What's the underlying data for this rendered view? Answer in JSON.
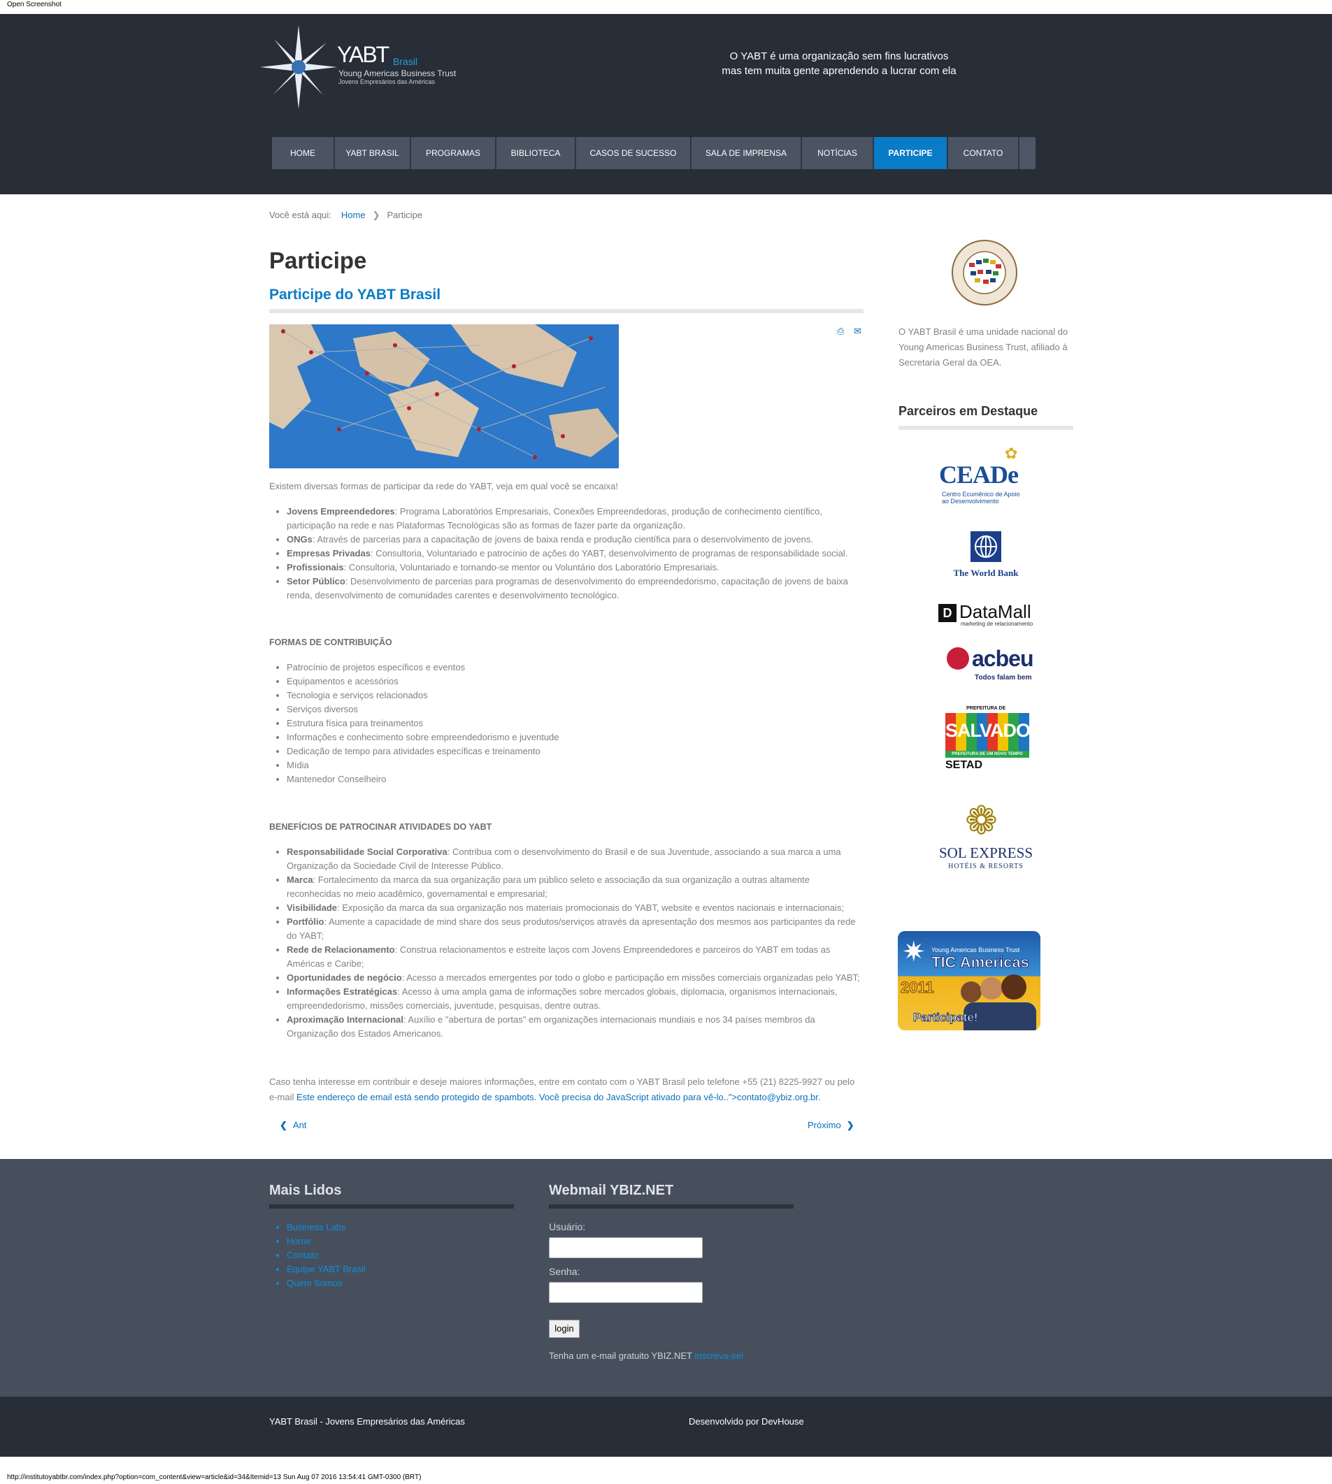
{
  "browser": {
    "top_label": "Open Screenshot",
    "status_url": "http://institutoyabtbr.com/index.php?option=com_content&view=article&id=34&Itemid=13 Sun Aug 07 2016 13:54:41 GMT-0300 (BRT)"
  },
  "header": {
    "logo": {
      "name": "YABT",
      "country": "Brasil",
      "line1": "Young Americas Business Trust",
      "line2": "Jovens Empresários das Américas"
    },
    "tagline_1": "O YABT é uma organização sem fins lucrativos",
    "tagline_2": "mas tem muita gente aprendendo a lucrar com ela"
  },
  "nav": [
    "HOME",
    "YABT BRASIL",
    "PROGRAMAS",
    "BIBLIOTECA",
    "CASOS DE SUCESSO",
    "SALA DE IMPRENSA",
    "NOTÍCIAS",
    "PARTICIPE",
    "CONTATO"
  ],
  "nav_active": "PARTICIPE",
  "breadcrumb": {
    "prefix": "Você está aqui:",
    "home": "Home",
    "current": "Participe"
  },
  "article": {
    "title": "Participe",
    "subtitle": "Participe do YABT Brasil",
    "intro": "Existem diversas formas de participar da rede do YABT, veja em qual você se encaixa!",
    "audiences": [
      {
        "term": "Jovens Empreendedores",
        "desc": ": Programa Laboratórios Empresariais, Conexões Empreendedoras, produção de conhecimento científico, participação na rede e nas Plataformas Tecnológicas são as formas de fazer parte da organização."
      },
      {
        "term": "ONGs",
        "desc": ": Através de parcerias para a capacitação de jovens de baixa renda e produção científica para o desenvolvimento de jovens."
      },
      {
        "term": "Empresas Privadas",
        "desc": ": Consultoria, Voluntariado e patrocínio de ações do YABT, desenvolvimento de programas de responsabilidade social."
      },
      {
        "term": "Profissionais",
        "desc": ": Consultoria, Voluntariado e tornando-se mentor ou Voluntário dos Laboratório Empresariais."
      },
      {
        "term": "Setor Público",
        "desc": ": Desenvolvimento de parcerias para programas de desenvolvimento do empreendedorismo, capacitação de jovens de baixa renda, desenvolvimento de comunidades carentes e desenvolvimento tecnológico."
      }
    ],
    "contrib_head": "FORMAS DE CONTRIBUIÇÃO",
    "contrib": [
      "Patrocínio de projetos específicos e eventos",
      "Equipamentos e acessórios",
      "Tecnologia e serviços relacionados",
      "Serviços diversos",
      "Estrutura física para treinamentos",
      "Informações e conhecimento sobre empreendedorismo e juventude",
      "Dedicação de tempo para atividades específicas e treinamento",
      "Mídia",
      "Mantenedor Conselheiro"
    ],
    "benefits_head": "BENEFÍCIOS DE PATROCINAR ATIVIDADES DO YABT",
    "benefits": [
      {
        "term": "Responsabilidade Social Corporativa",
        "desc": ": Contribua com o desenvolvimento do Brasil e de sua Juventude, associando a sua marca a uma Organização da Sociedade Civil de Interesse Público."
      },
      {
        "term": "Marca",
        "desc": ": Fortalecimento da marca da sua organização para um público seleto e associação da sua organização a outras altamente reconhecidas no meio acadêmico, governamental e empresarial;"
      },
      {
        "term": "Visibilidade",
        "desc": ": Exposição da marca da sua organização nos materiais promocionais do YABT, website e eventos nacionais e internacionais;"
      },
      {
        "term": "Portfólio",
        "desc": ": Aumente a capacidade de mind share dos seus produtos/serviços através da apresentação dos mesmos aos participantes da rede do YABT;"
      },
      {
        "term": "Rede de Relacionamento",
        "desc": ": Construa relacionamentos e estreite laços com Jovens Empreendedores e parceiros do YABT em todas as Américas e Caribe;"
      },
      {
        "term": "Oportunidades de negócio",
        "desc": ": Acesso a mercados emergentes por todo o globo e participação em missões comerciais organizadas pelo YABT;"
      },
      {
        "term": "Informações Estratégicas",
        "desc": ": Acesso à uma ampla gama de informações sobre mercados globais, diplomacia, organismos internacionais, empreendedorismo, missões comerciais, juventude, pesquisas, dentre outras."
      },
      {
        "term": "Aproximação Internacional",
        "desc": ": Auxílio e \"abertura de portas\" em organizações internacionais mundiais e nos 34 países membros da Organização dos Estados Americanos."
      }
    ],
    "closing_pre": "Caso tenha interesse em contribuir e deseje maiores informações, entre em contato com o YABT Brasil pelo telefone +55 (21) 8225-9927 ou pelo e-mail ",
    "closing_link": "Este endereço de email está sendo protegido de spambots. Você precisa do JavaScript ativado para vê-lo..\">contato@ybiz.org.br.",
    "prev": "Ant",
    "next": "Próximo",
    "icons": [
      "print-icon",
      "email-icon"
    ]
  },
  "sidebar": {
    "oea_seal_text": "ORGANIZAÇÃO DOS ESTADOS AMERICANOS",
    "about": "O YABT Brasil é uma unidade nacional do Young Americas Business Trust, afiliado à Secretaria Geral da OEA.",
    "partners_head": "Parceiros em Destaque",
    "partners": [
      {
        "name": "CEADe",
        "sub": "Centro Ecumênico de Apoio ao Desenvolvimento"
      },
      {
        "name": "The World Bank"
      },
      {
        "name": "DataMall",
        "sub": "marketing de relacionamento"
      },
      {
        "name": "acbeu",
        "sub": "Todos falam bem"
      },
      {
        "name": "SALVADOR",
        "top": "PREFEITURA DE",
        "band": "PREFEITURA DE UM NOVO TEMPO",
        "sub": "SETAD"
      },
      {
        "name": "SOL EXPRESS",
        "sub": "HOTÉIS & RESORTS"
      }
    ],
    "banner": {
      "top": "Young Americas Business Trust",
      "title": "TIC Americas",
      "year": "2011",
      "cta": "Participate!"
    }
  },
  "footer": {
    "col1_head": "Mais Lidos",
    "col1_links": [
      "Business Labs",
      "Home",
      "Contato",
      "Equipe YABT Brasil",
      "Quem Somos"
    ],
    "col2_head": "Webmail YBIZ.NET",
    "user_label": "Usuário:",
    "pass_label": "Senha:",
    "login": "login",
    "signup_pre": "Tenha um e-mail gratuito YBIZ.NET ",
    "signup_link": "inscreva-se!"
  },
  "bottom": {
    "left": "YABT Brasil - Jovens Empresários das Américas",
    "right": "Desenvolvido por DevHouse"
  }
}
